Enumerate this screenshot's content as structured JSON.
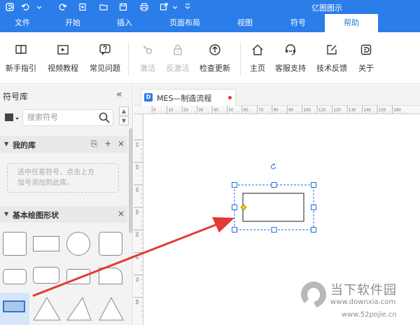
{
  "window": {
    "title": "亿图图示"
  },
  "quick_access": [
    "logo-icon",
    "undo-icon",
    "redo-icon",
    "new-icon",
    "open-icon",
    "save-icon",
    "print-icon",
    "export-icon"
  ],
  "menu": {
    "tabs": [
      {
        "label": "文件"
      },
      {
        "label": "开始"
      },
      {
        "label": "插入"
      },
      {
        "label": "页面布局"
      },
      {
        "label": "视图"
      },
      {
        "label": "符号"
      },
      {
        "label": "帮助"
      }
    ],
    "active": "帮助"
  },
  "ribbon": {
    "buttons": [
      {
        "label": "新手指引",
        "icon": "book-icon",
        "enabled": true
      },
      {
        "label": "视频教程",
        "icon": "video-icon",
        "enabled": true
      },
      {
        "label": "常见问题",
        "icon": "question-icon",
        "enabled": true
      },
      {
        "label": "激活",
        "icon": "key-icon",
        "enabled": false
      },
      {
        "label": "反激活",
        "icon": "lock-icon",
        "enabled": false
      },
      {
        "label": "检查更新",
        "icon": "update-icon",
        "enabled": true
      },
      {
        "label": "主页",
        "icon": "home-icon",
        "enabled": true
      },
      {
        "label": "客服支持",
        "icon": "headset-icon",
        "enabled": true
      },
      {
        "label": "技术反馈",
        "icon": "feedback-icon",
        "enabled": true
      },
      {
        "label": "关于",
        "icon": "about-icon",
        "enabled": true
      }
    ]
  },
  "symbol_library": {
    "title": "符号库",
    "search_placeholder": "搜索符号",
    "my_library": {
      "title": "我的库",
      "hint_line1": "选中任意符号，点击上方",
      "hint_line2": "加号添加到此库。"
    },
    "basic_shapes": {
      "title": "基本绘图形状"
    }
  },
  "document": {
    "tab_name": "MES—制造流程",
    "modified": true
  },
  "rulers": {
    "horizontal_ticks": [
      "0",
      "10",
      "20",
      "30",
      "40",
      "50",
      "60",
      "70",
      "80",
      "90",
      "100",
      "110",
      "120",
      "130",
      "140",
      "150",
      "160"
    ],
    "vertical_ticks": [
      "10",
      "20",
      "30",
      "40",
      "50",
      "60",
      "70",
      "80"
    ]
  },
  "watermark": {
    "line1": "当下软件园",
    "line2": "www.downxia.com",
    "line3": "www.52pojie.cn"
  },
  "colors": {
    "accent": "#2b7de9",
    "selection": "#1e6fe0",
    "arrow": "#e53935"
  }
}
